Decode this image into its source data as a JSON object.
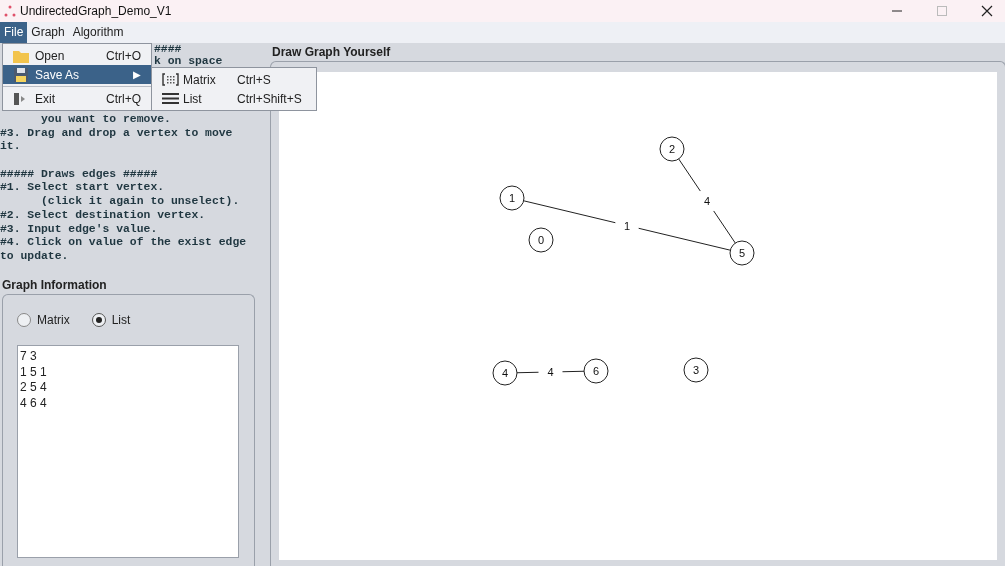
{
  "window": {
    "title": "UndirectedGraph_Demo_V1"
  },
  "menu_bar": [
    {
      "label": "File",
      "selected": true
    },
    {
      "label": "Graph",
      "selected": false
    },
    {
      "label": "Algorithm",
      "selected": false
    }
  ],
  "file_menu": [
    {
      "kind": "item",
      "label": "Open",
      "shortcut": "Ctrl+O",
      "selected": false
    },
    {
      "kind": "submenu",
      "label": "Save As",
      "selected": true,
      "arrow": "▶"
    },
    {
      "kind": "item",
      "label": "Exit",
      "shortcut": "Ctrl+Q",
      "selected": false
    }
  ],
  "save_as_menu": [
    {
      "label": "Matrix",
      "shortcut": "Ctrl+S"
    },
    {
      "label": "List",
      "shortcut": "Ctrl+Shift+S"
    }
  ],
  "instructions": {
    "fragments": [
      "####",
      "k on space"
    ],
    "lines": [
      "      you want to remove.",
      "#3. Drag and drop a vertex to move",
      "it."
    ],
    "lines_2": [
      "##### Draws edges #####",
      "#1. Select start vertex.",
      "      (click it again to unselect).",
      "#2. Select destination vertex.",
      "#3. Input edge's value.",
      "#4. Click on value of the exist edge",
      "to update."
    ]
  },
  "graph_information": {
    "title": "Graph Information",
    "modes": [
      {
        "label": "Matrix",
        "selected": false
      },
      {
        "label": "List",
        "selected": true
      }
    ],
    "output_lines": [
      "7 3",
      "1 5 1",
      "2 5 4",
      "4 6 4"
    ]
  },
  "canvas": {
    "title": "Draw Graph Yourself",
    "vertices": [
      "2",
      "1",
      "0",
      "5",
      "4",
      "6",
      "3"
    ],
    "edges": [
      {
        "value": "1"
      },
      {
        "value": "4"
      },
      {
        "value": "4"
      }
    ]
  }
}
